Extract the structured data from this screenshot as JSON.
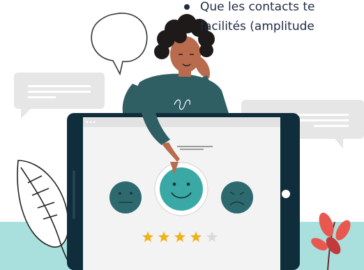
{
  "text": {
    "bullet_line1": "Que les contacts te",
    "bullet_line2": "facilités (amplitude"
  },
  "rating": {
    "stars_filled": 4,
    "stars_total": 5,
    "selected_face": "happy"
  },
  "colors": {
    "teal_light": "#a9e0de",
    "teal_face": "#3aa9a6",
    "teal_dark": "#2d6a6f",
    "tablet_frame": "#0f2d3a",
    "skin": "#b86b4d",
    "hair": "#1f1a1a",
    "sweater": "#2f5e63",
    "star": "#f0b21a",
    "star_empty": "#d9d9d9",
    "bubble_gray": "#e6e6e6",
    "plant_red": "#e8584f"
  }
}
